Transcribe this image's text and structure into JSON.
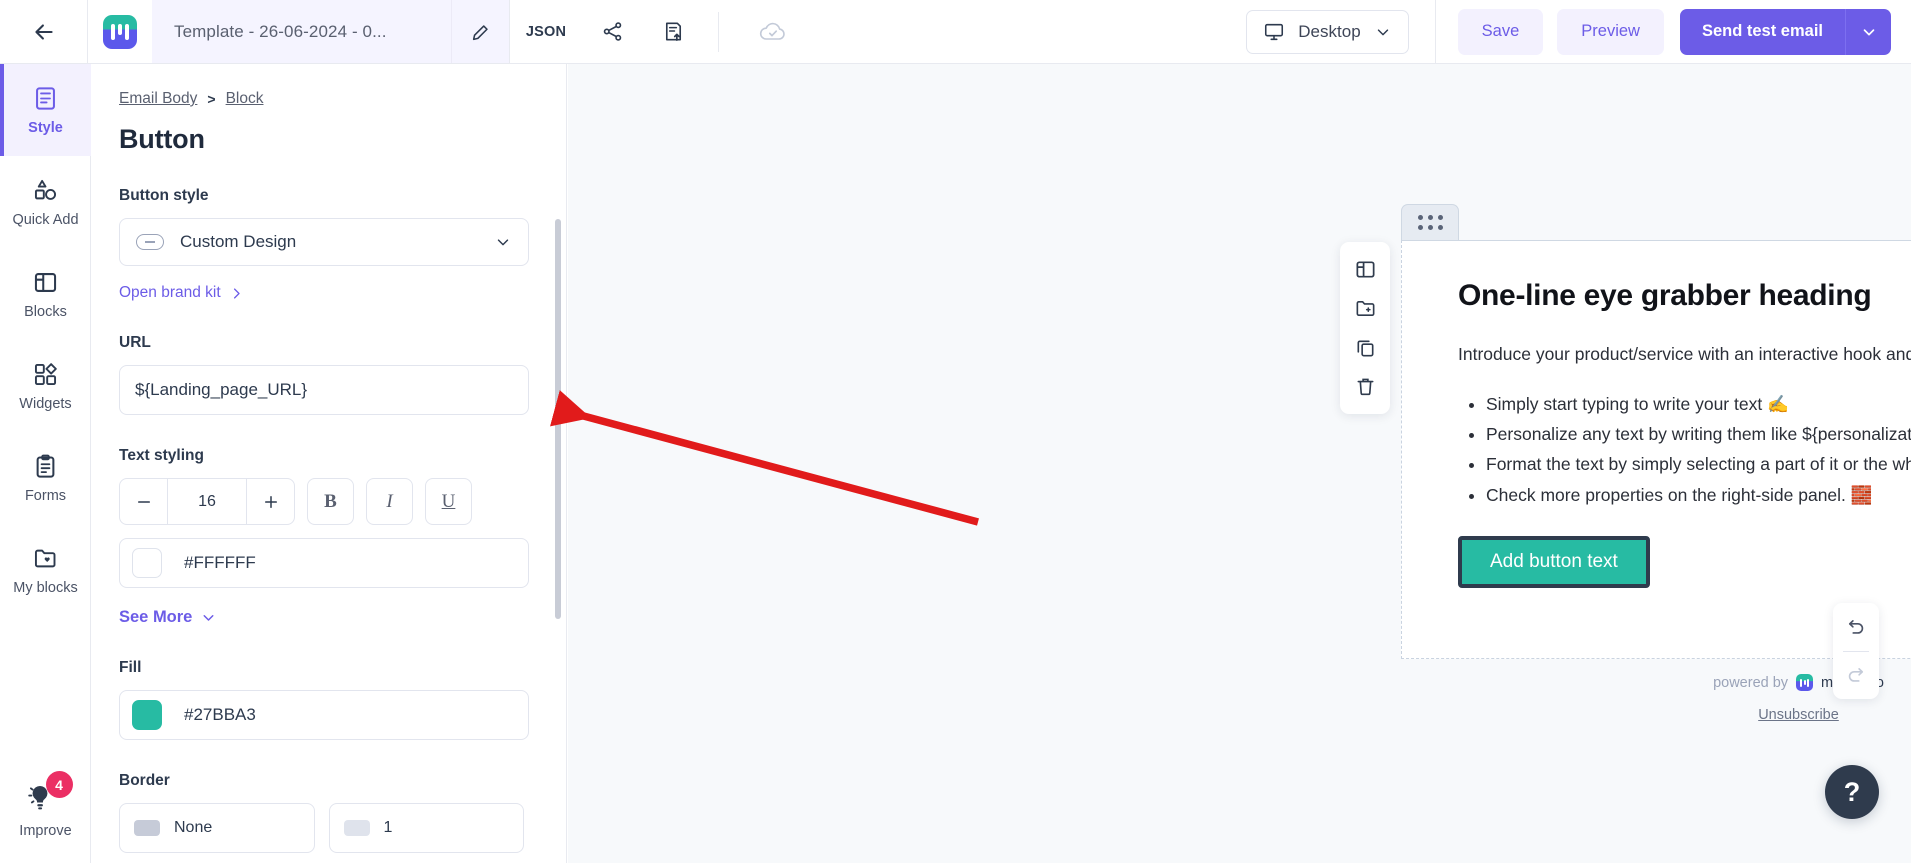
{
  "topbar": {
    "back_icon": "arrow-left-icon",
    "logo": "mailmodo-logo",
    "template_title": "Template - 26-06-2024 - 0...",
    "edit_icon": "pencil-icon",
    "json_label": "JSON",
    "share_icon": "share-icon",
    "export_icon": "export-document-icon",
    "cloud_icon": "cloud-saved-icon",
    "device": {
      "label": "Desktop",
      "icon": "desktop-icon",
      "caret": "chevron-down-icon"
    },
    "save_label": "Save",
    "preview_label": "Preview",
    "send_test_label": "Send test email",
    "send_caret": "chevron-down-icon"
  },
  "rail": {
    "items": [
      {
        "label": "Style",
        "icon": "style-document-icon",
        "active": true
      },
      {
        "label": "Quick Add",
        "icon": "shapes-icon",
        "active": false
      },
      {
        "label": "Blocks",
        "icon": "layout-blocks-icon",
        "active": false
      },
      {
        "label": "Widgets",
        "icon": "widgets-grid-icon",
        "active": false
      },
      {
        "label": "Forms",
        "icon": "clipboard-forms-icon",
        "active": false
      },
      {
        "label": "My blocks",
        "icon": "folder-heart-icon",
        "active": false
      }
    ],
    "improve": {
      "label": "Improve",
      "icon": "lightbulb-icon",
      "badge": "4"
    }
  },
  "panel": {
    "breadcrumb": {
      "root": "Email Body",
      "separator": ">",
      "current": "Block"
    },
    "title": "Button",
    "button_style": {
      "label": "Button style",
      "value": "Custom Design",
      "icon": "button-pill-icon",
      "caret": "chevron-down-icon"
    },
    "brand_kit_link": "Open brand kit",
    "url": {
      "label": "URL",
      "value": "${Landing_page_URL}"
    },
    "text_styling": {
      "label": "Text styling",
      "font_size": "16",
      "minus": "−",
      "plus": "+",
      "bold": "B",
      "italic": "I",
      "underline": "U",
      "color_value": "#FFFFFF",
      "color_hex": "#FFFFFF",
      "see_more": "See More"
    },
    "fill": {
      "label": "Fill",
      "value": "#27BBA3",
      "hex": "#27BBA3"
    },
    "border": {
      "label": "Border",
      "style_value": "None",
      "width_value": "1"
    }
  },
  "canvas": {
    "drag_handle": "drag-dots-handle",
    "block_tools": [
      {
        "icon": "layout-icon",
        "name": "layout-tool"
      },
      {
        "icon": "save-to-folder-icon",
        "name": "save-block-tool"
      },
      {
        "icon": "duplicate-icon",
        "name": "duplicate-tool"
      },
      {
        "icon": "trash-icon",
        "name": "delete-tool"
      }
    ],
    "email": {
      "heading": "One-line eye grabber heading",
      "paragraph": "Introduce your product/service with an interactive hook and an appealing image above.",
      "bullets": [
        "Simply start typing to write your text ✍️",
        "Personalize any text by writing them like ${personalization_text} 💬",
        "Format the text by simply selecting a part of it or the whole text 🖌️",
        "Check more properties on the right-side panel. 🧱"
      ],
      "cta_label": "Add button text",
      "cta_fill": "#27BBA3"
    },
    "footer": {
      "powered_by": "powered by",
      "brand": "mailmodo",
      "unsubscribe": "Unsubscribe"
    }
  },
  "floating": {
    "undo_icon": "undo-icon",
    "redo_icon": "redo-icon",
    "help_label": "?"
  },
  "annotation": {
    "arrow_color": "#E11B1B",
    "description": "red-arrow-from-cta-to-url-field"
  }
}
